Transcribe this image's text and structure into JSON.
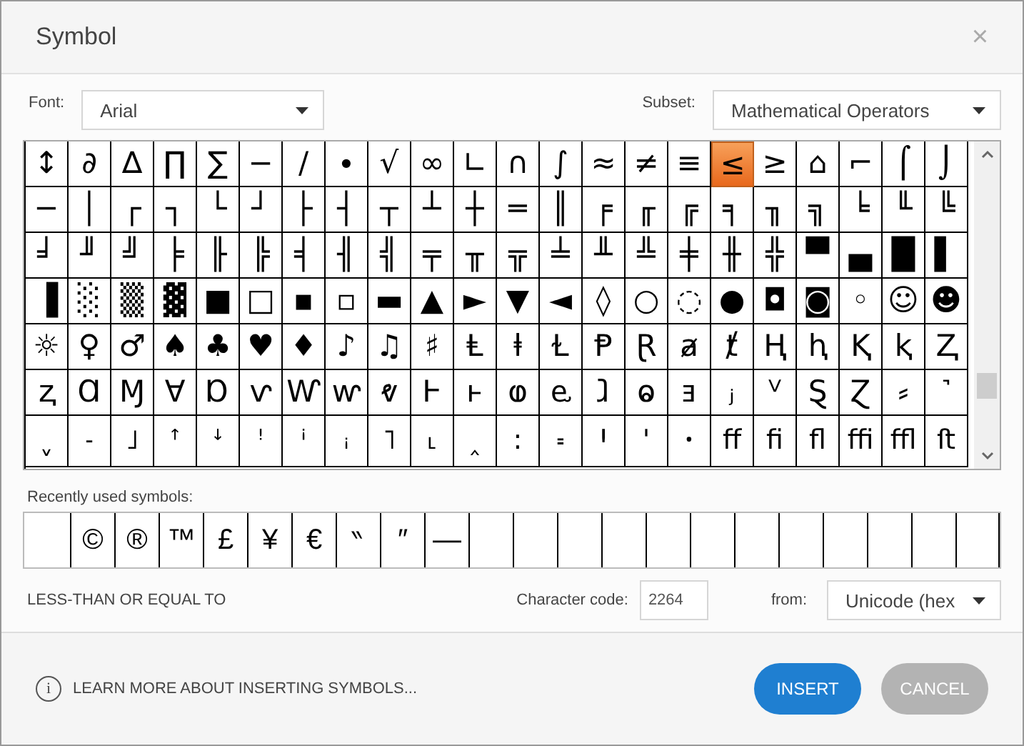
{
  "window": {
    "title": "Symbol",
    "close": "×"
  },
  "font": {
    "label": "Font:",
    "value": "Arial"
  },
  "subset": {
    "label": "Subset:",
    "value": "Mathematical Operators"
  },
  "grid": [
    [
      {
        "char": "↕",
        "selected": false
      },
      {
        "char": "∂",
        "selected": false
      },
      {
        "char": "∆",
        "selected": false
      },
      {
        "char": "∏",
        "selected": false
      },
      {
        "char": "∑",
        "selected": false
      },
      {
        "char": "−",
        "selected": false
      },
      {
        "char": "∕",
        "selected": false
      },
      {
        "char": "∙",
        "selected": false
      },
      {
        "char": "√",
        "selected": false
      },
      {
        "char": "∞",
        "selected": false
      },
      {
        "char": "∟",
        "selected": false
      },
      {
        "char": "∩",
        "selected": false
      },
      {
        "char": "∫",
        "selected": false
      },
      {
        "char": "≈",
        "selected": false
      },
      {
        "char": "≠",
        "selected": false
      },
      {
        "char": "≡",
        "selected": false
      },
      {
        "char": "≤",
        "selected": true
      },
      {
        "char": "≥",
        "selected": false
      },
      {
        "char": "⌂",
        "selected": false
      },
      {
        "char": "⌐",
        "selected": false
      },
      {
        "char": "⌠",
        "selected": false
      },
      {
        "char": "⌡",
        "selected": false
      }
    ],
    [
      {
        "char": "─",
        "selected": false
      },
      {
        "char": "│",
        "selected": false
      },
      {
        "char": "┌",
        "selected": false
      },
      {
        "char": "┐",
        "selected": false
      },
      {
        "char": "└",
        "selected": false
      },
      {
        "char": "┘",
        "selected": false
      },
      {
        "char": "├",
        "selected": false
      },
      {
        "char": "┤",
        "selected": false
      },
      {
        "char": "┬",
        "selected": false
      },
      {
        "char": "┴",
        "selected": false
      },
      {
        "char": "┼",
        "selected": false
      },
      {
        "char": "═",
        "selected": false
      },
      {
        "char": "║",
        "selected": false
      },
      {
        "char": "╒",
        "selected": false
      },
      {
        "char": "╓",
        "selected": false
      },
      {
        "char": "╔",
        "selected": false
      },
      {
        "char": "╕",
        "selected": false
      },
      {
        "char": "╖",
        "selected": false
      },
      {
        "char": "╗",
        "selected": false
      },
      {
        "char": "╘",
        "selected": false
      },
      {
        "char": "╙",
        "selected": false
      },
      {
        "char": "╚",
        "selected": false
      }
    ],
    [
      {
        "char": "╛",
        "selected": false
      },
      {
        "char": "╜",
        "selected": false
      },
      {
        "char": "╝",
        "selected": false
      },
      {
        "char": "╞",
        "selected": false
      },
      {
        "char": "╟",
        "selected": false
      },
      {
        "char": "╠",
        "selected": false
      },
      {
        "char": "╡",
        "selected": false
      },
      {
        "char": "╢",
        "selected": false
      },
      {
        "char": "╣",
        "selected": false
      },
      {
        "char": "╤",
        "selected": false
      },
      {
        "char": "╥",
        "selected": false
      },
      {
        "char": "╦",
        "selected": false
      },
      {
        "char": "╧",
        "selected": false
      },
      {
        "char": "╨",
        "selected": false
      },
      {
        "char": "╩",
        "selected": false
      },
      {
        "char": "╪",
        "selected": false
      },
      {
        "char": "╫",
        "selected": false
      },
      {
        "char": "╬",
        "selected": false
      },
      {
        "char": "▀",
        "selected": false
      },
      {
        "char": "▄",
        "selected": false
      },
      {
        "char": "█",
        "selected": false
      },
      {
        "char": "▌",
        "selected": false
      }
    ],
    [
      {
        "char": "▐",
        "selected": false
      },
      {
        "char": "░",
        "selected": false
      },
      {
        "char": "▒",
        "selected": false
      },
      {
        "char": "▓",
        "selected": false
      },
      {
        "char": "■",
        "selected": false
      },
      {
        "char": "□",
        "selected": false
      },
      {
        "char": "▪",
        "selected": false
      },
      {
        "char": "▫",
        "selected": false
      },
      {
        "char": "▬",
        "selected": false
      },
      {
        "char": "▲",
        "selected": false
      },
      {
        "char": "►",
        "selected": false
      },
      {
        "char": "▼",
        "selected": false
      },
      {
        "char": "◄",
        "selected": false
      },
      {
        "char": "◊",
        "selected": false
      },
      {
        "char": "○",
        "selected": false
      },
      {
        "char": "◌",
        "selected": false
      },
      {
        "char": "●",
        "selected": false
      },
      {
        "char": "◘",
        "selected": false
      },
      {
        "char": "◙",
        "selected": false
      },
      {
        "char": "◦",
        "selected": false
      },
      {
        "char": "☺",
        "selected": false
      },
      {
        "char": "☻",
        "selected": false
      }
    ],
    [
      {
        "char": "☼",
        "selected": false
      },
      {
        "char": "♀",
        "selected": false
      },
      {
        "char": "♂",
        "selected": false
      },
      {
        "char": "♠",
        "selected": false
      },
      {
        "char": "♣",
        "selected": false
      },
      {
        "char": "♥",
        "selected": false
      },
      {
        "char": "♦",
        "selected": false
      },
      {
        "char": "♪",
        "selected": false
      },
      {
        "char": "♫",
        "selected": false
      },
      {
        "char": "♯",
        "selected": false
      },
      {
        "char": "Ⱡ",
        "selected": false
      },
      {
        "char": "ⱡ",
        "selected": false
      },
      {
        "char": "Ɫ",
        "selected": false
      },
      {
        "char": "Ᵽ",
        "selected": false
      },
      {
        "char": "Ɽ",
        "selected": false
      },
      {
        "char": "ⱥ",
        "selected": false
      },
      {
        "char": "ⱦ",
        "selected": false
      },
      {
        "char": "Ⱨ",
        "selected": false
      },
      {
        "char": "ⱨ",
        "selected": false
      },
      {
        "char": "Ⱪ",
        "selected": false
      },
      {
        "char": "ⱪ",
        "selected": false
      },
      {
        "char": "Ⱬ",
        "selected": false
      }
    ],
    [
      {
        "char": "ⱬ",
        "selected": false
      },
      {
        "char": "Ɑ",
        "selected": false
      },
      {
        "char": "Ɱ",
        "selected": false
      },
      {
        "char": "Ɐ",
        "selected": false
      },
      {
        "char": "Ɒ",
        "selected": false
      },
      {
        "char": "ⱱ",
        "selected": false
      },
      {
        "char": "Ⱳ",
        "selected": false
      },
      {
        "char": "ⱳ",
        "selected": false
      },
      {
        "char": "ⱴ",
        "selected": false
      },
      {
        "char": "Ⱶ",
        "selected": false
      },
      {
        "char": "ⱶ",
        "selected": false
      },
      {
        "char": "ⱷ",
        "selected": false
      },
      {
        "char": "ⱸ",
        "selected": false
      },
      {
        "char": "ⱹ",
        "selected": false
      },
      {
        "char": "ⱺ",
        "selected": false
      },
      {
        "char": "ⱻ",
        "selected": false
      },
      {
        "char": "ⱼ",
        "selected": false
      },
      {
        "char": "ⱽ",
        "selected": false
      },
      {
        "char": "Ȿ",
        "selected": false
      },
      {
        "char": "Ɀ",
        "selected": false
      },
      {
        "char": "⸗",
        "selected": false
      },
      {
        "char": "˺",
        "selected": false
      }
    ],
    [
      {
        "char": "ˬ",
        "selected": false
      },
      {
        "char": "˗",
        "selected": false
      },
      {
        "char": "˩",
        "selected": false
      },
      {
        "char": "ꜛ",
        "selected": false
      },
      {
        "char": "ꜜ",
        "selected": false
      },
      {
        "char": "ꜝ",
        "selected": false
      },
      {
        "char": "ꜞ",
        "selected": false
      },
      {
        "char": "ꜟ",
        "selected": false
      },
      {
        "char": "˥",
        "selected": false
      },
      {
        "char": "˪",
        "selected": false
      },
      {
        "char": "‸",
        "selected": false
      },
      {
        "char": "꞉",
        "selected": false
      },
      {
        "char": "꞊",
        "selected": false
      },
      {
        "char": "Ꞌ",
        "selected": false
      },
      {
        "char": "ꞌ",
        "selected": false
      },
      {
        "char": "ꞏ",
        "selected": false
      },
      {
        "char": "ﬀ",
        "selected": false
      },
      {
        "char": "ﬁ",
        "selected": false
      },
      {
        "char": "ﬂ",
        "selected": false
      },
      {
        "char": "ﬃ",
        "selected": false
      },
      {
        "char": "ﬄ",
        "selected": false
      },
      {
        "char": "ﬅ",
        "selected": false
      }
    ]
  ],
  "recent": {
    "label": "Recently used symbols:",
    "symbols": [
      "©",
      "®",
      "™",
      "£",
      "¥",
      "€",
      "‶",
      "″",
      "—"
    ]
  },
  "description": "LESS-THAN OR EQUAL TO",
  "character_code": {
    "label": "Character code:",
    "value": "2264"
  },
  "from": {
    "label": "from:",
    "value": "Unicode (hex"
  },
  "footer": {
    "link": "LEARN MORE ABOUT INSERTING SYMBOLS...",
    "info": "i",
    "buttons": [
      "INSERT",
      "CANCEL"
    ]
  }
}
